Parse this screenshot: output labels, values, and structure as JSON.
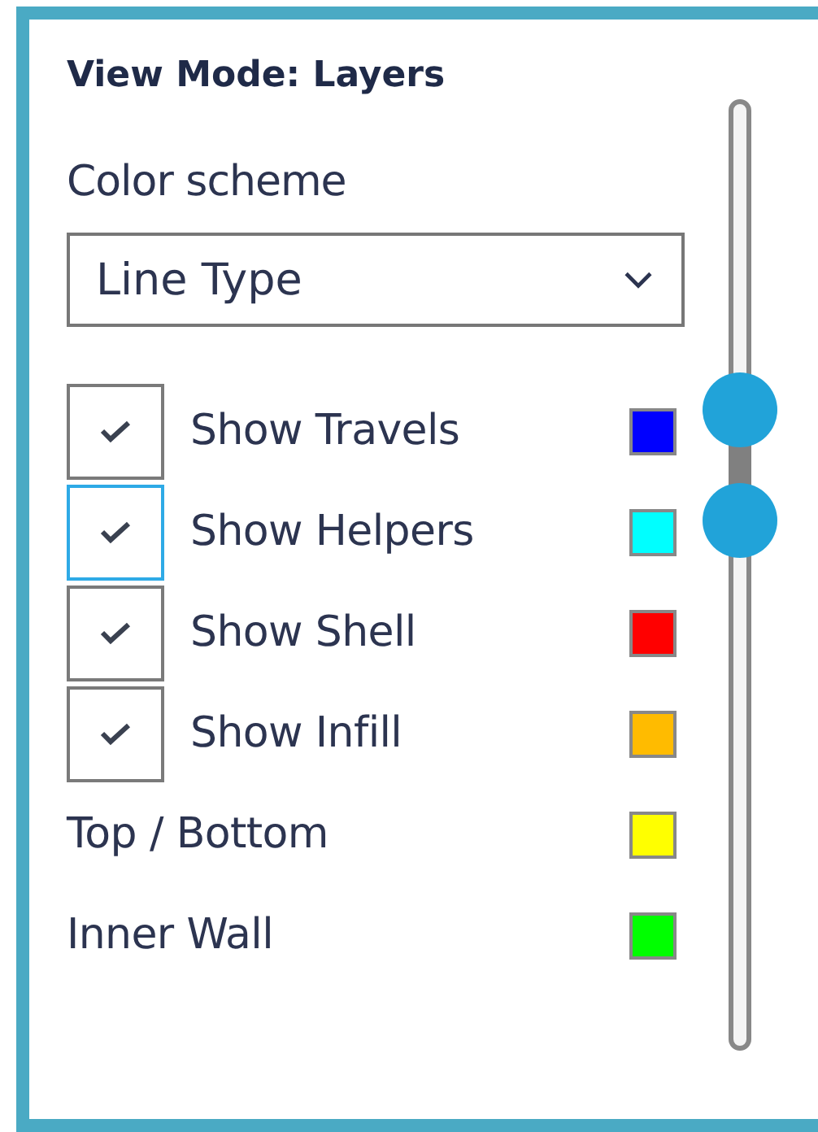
{
  "panel": {
    "title": "View Mode: Layers",
    "color_scheme_label": "Color scheme",
    "color_scheme": {
      "value": "Line Type"
    },
    "rows": [
      {
        "kind": "checkbox",
        "label": "Show Travels",
        "checked": true,
        "focused": false,
        "color": "#0000ff"
      },
      {
        "kind": "checkbox",
        "label": "Show Helpers",
        "checked": true,
        "focused": true,
        "color": "#00ffff"
      },
      {
        "kind": "checkbox",
        "label": "Show Shell",
        "checked": true,
        "focused": false,
        "color": "#ff0000"
      },
      {
        "kind": "checkbox",
        "label": "Show Infill",
        "checked": true,
        "focused": false,
        "color": "#ffbb00"
      },
      {
        "kind": "legend",
        "label": "Top / Bottom",
        "color": "#ffff00"
      },
      {
        "kind": "legend",
        "label": "Inner Wall",
        "color": "#00ff00"
      }
    ],
    "layer_slider": {
      "handles": [
        {
          "level": 0.674
        },
        {
          "level": 0.557
        }
      ]
    }
  }
}
